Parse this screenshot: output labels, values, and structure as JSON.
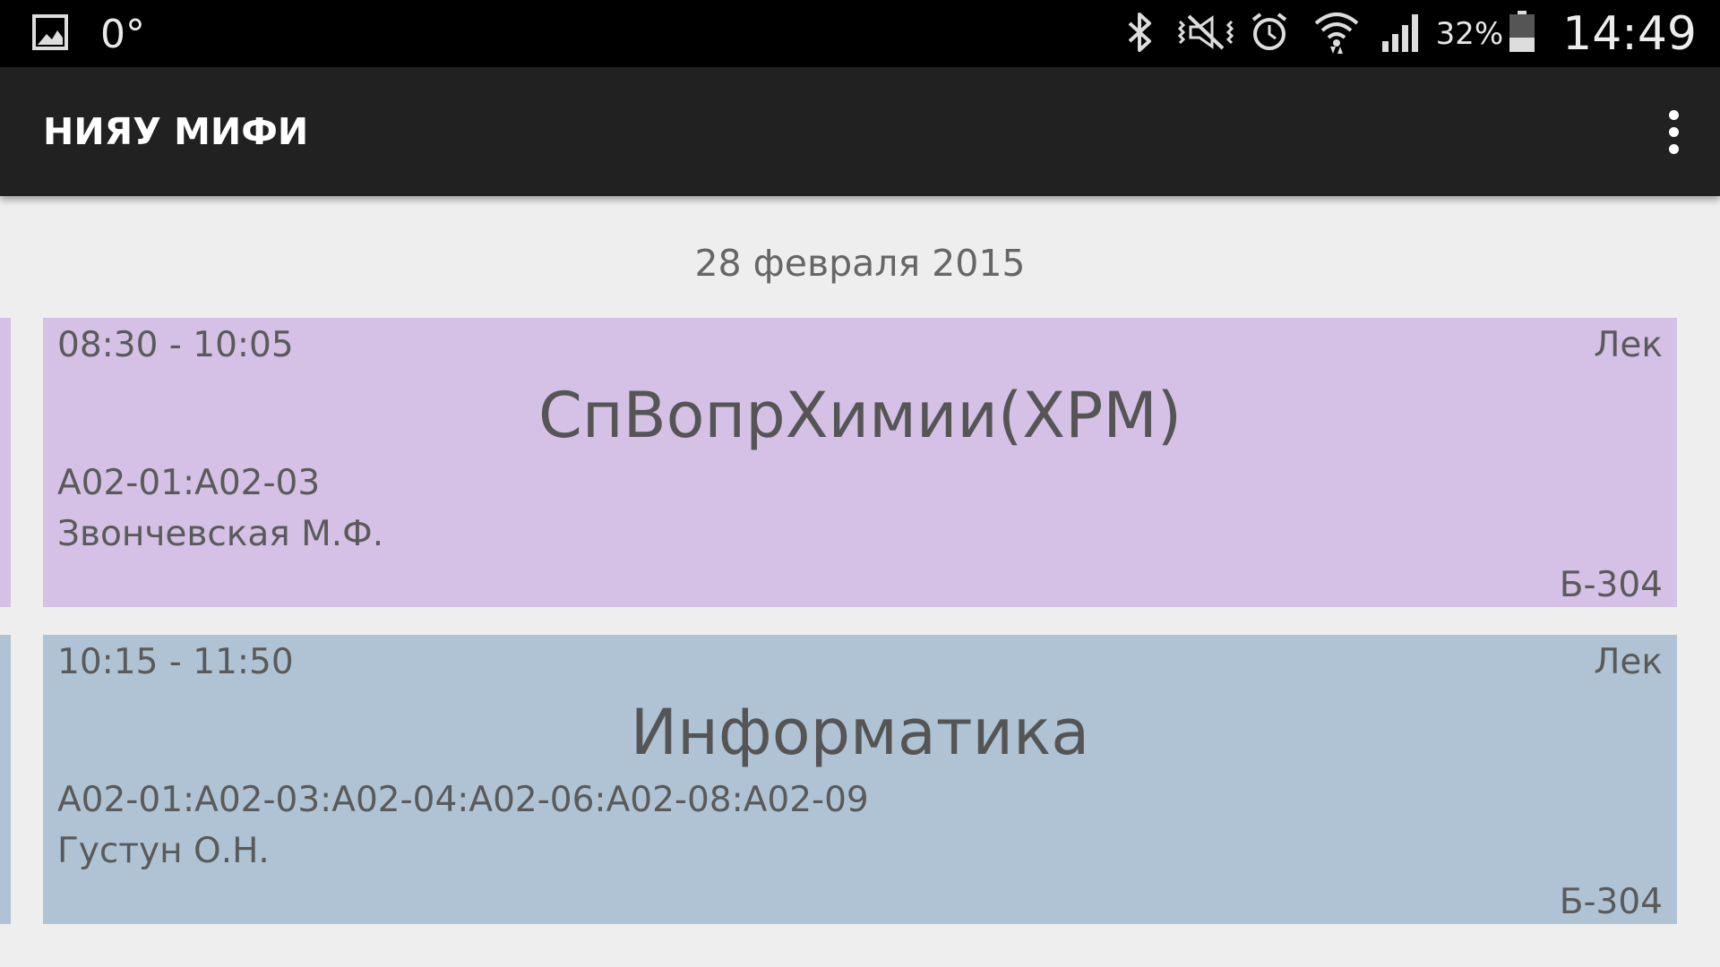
{
  "status_bar": {
    "left_icon": "image-notification-icon",
    "temperature": "0°",
    "icons": [
      "bluetooth-icon",
      "vibrate-icon",
      "alarm-icon",
      "wifi-icon",
      "signal-icon",
      "battery-icon"
    ],
    "battery_percent": "32%",
    "clock": "14:49"
  },
  "action_bar": {
    "title": "НИЯУ МИФИ",
    "overflow_icon": "more-vert-icon"
  },
  "schedule": {
    "date": "28 февраля 2015",
    "lessons": [
      {
        "time": "08:30 - 10:05",
        "type": "Лек",
        "subject": "СпВопрХимии(ХРМ)",
        "groups": "А02-01:А02-03",
        "teacher": "Звончевская М.Ф.",
        "room": "Б-304",
        "color": "#d4c1e5"
      },
      {
        "time": "10:15 - 11:50",
        "type": "Лек",
        "subject": "Информатика",
        "groups": "А02-01:А02-03:А02-04:А02-06:А02-08:А02-09",
        "teacher": "Густун О.Н.",
        "room": "Б-304",
        "color": "#afc3d4"
      }
    ]
  }
}
